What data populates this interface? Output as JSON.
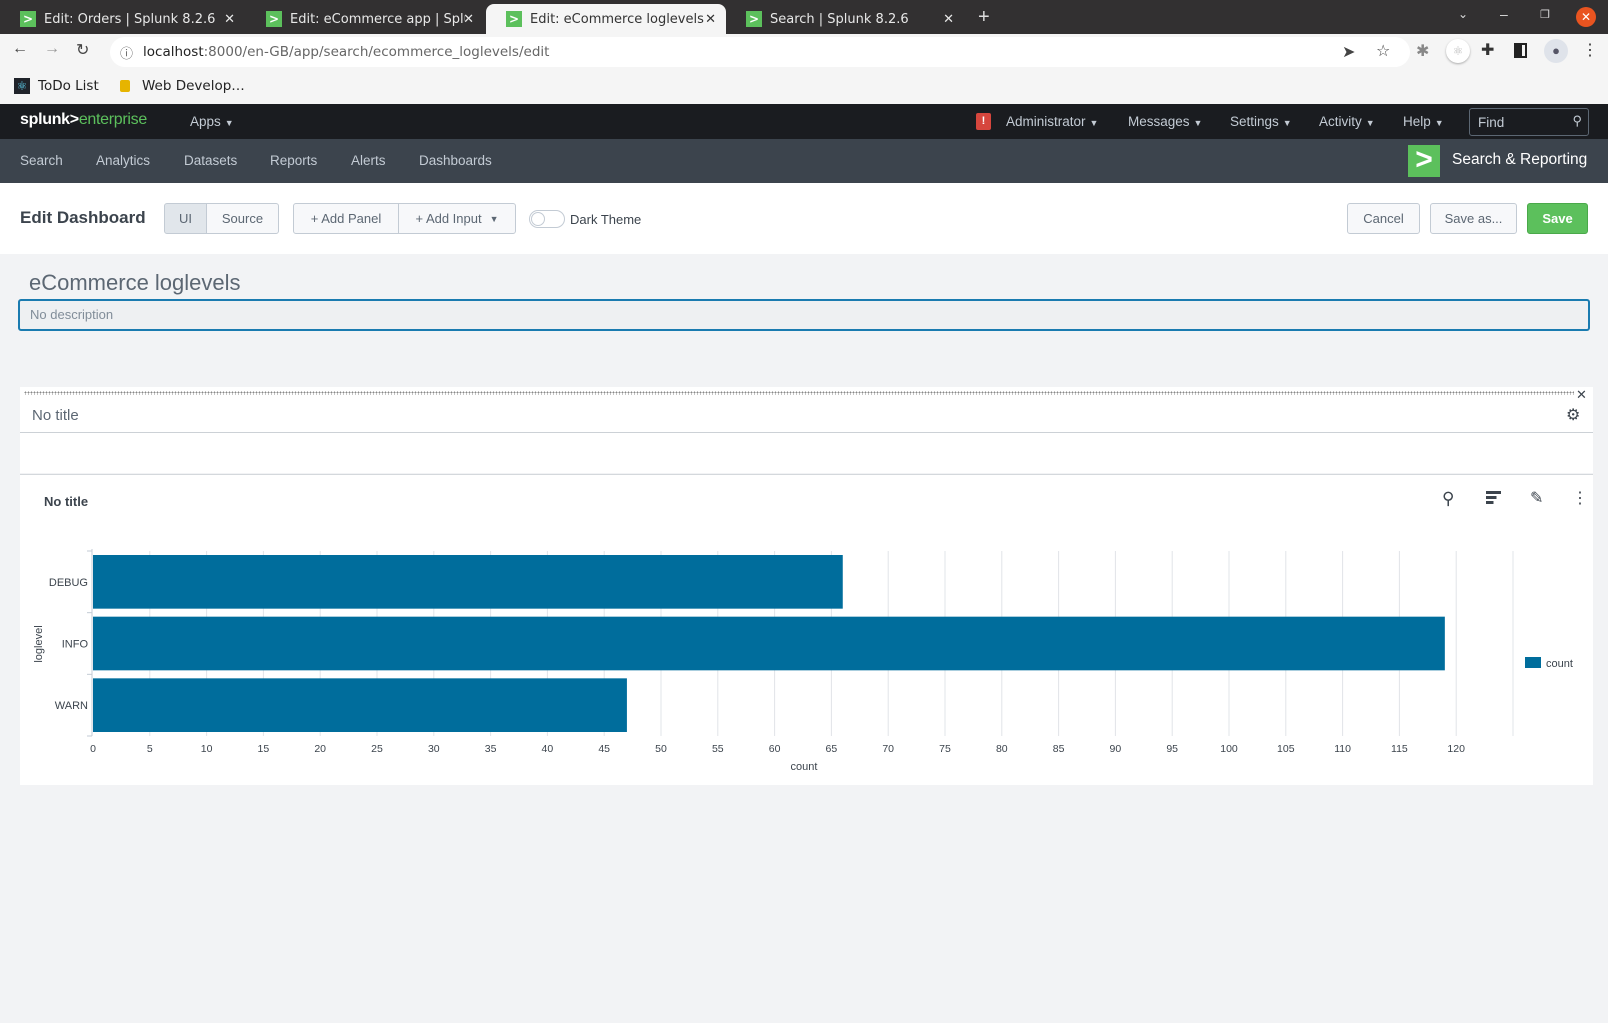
{
  "browser": {
    "tabs": [
      {
        "title": "Edit: Orders | Splunk 8.2.6",
        "active": false
      },
      {
        "title": "Edit: eCommerce app | Splunk",
        "active": false
      },
      {
        "title": "Edit: eCommerce loglevels",
        "active": true
      },
      {
        "title": "Search | Splunk 8.2.6",
        "active": false
      }
    ],
    "url_host": "localhost",
    "url_rest": ":8000/en-GB/app/search/ecommerce_loglevels/edit",
    "bookmarks": [
      {
        "label": "ToDo List"
      },
      {
        "label": "Web Develop…"
      }
    ]
  },
  "splunk": {
    "logo_left": "splunk>",
    "logo_right": "enterprise",
    "apps": "Apps",
    "top_menu": [
      "Administrator",
      "Messages",
      "Settings",
      "Activity",
      "Help"
    ],
    "find_placeholder": "Find",
    "app_nav": [
      "Search",
      "Analytics",
      "Datasets",
      "Reports",
      "Alerts",
      "Dashboards"
    ],
    "app_name": "Search & Reporting",
    "accent": "#5cc05c"
  },
  "editbar": {
    "title": "Edit Dashboard",
    "ui": "UI",
    "source": "Source",
    "add_panel": "+ Add Panel",
    "add_input": "+ Add Input",
    "dark_theme": "Dark Theme",
    "dark_theme_on": false,
    "cancel": "Cancel",
    "save_as": "Save as...",
    "save": "Save"
  },
  "dashboard": {
    "title": "eCommerce loglevels",
    "description_placeholder": "No description",
    "row_title": "No title",
    "panel_title": "No title"
  },
  "chart_data": {
    "type": "bar",
    "orientation": "horizontal",
    "categories": [
      "DEBUG",
      "INFO",
      "WARN"
    ],
    "series": [
      {
        "name": "count",
        "values": [
          66,
          119,
          47
        ],
        "color": "#006d9c"
      }
    ],
    "xlabel": "count",
    "ylabel": "loglevel",
    "xlim": [
      0,
      125
    ],
    "xticks": [
      0,
      5,
      10,
      15,
      20,
      25,
      30,
      35,
      40,
      45,
      50,
      55,
      60,
      65,
      70,
      75,
      80,
      85,
      90,
      95,
      100,
      105,
      110,
      115,
      120
    ],
    "grid": true,
    "legend": "right"
  }
}
